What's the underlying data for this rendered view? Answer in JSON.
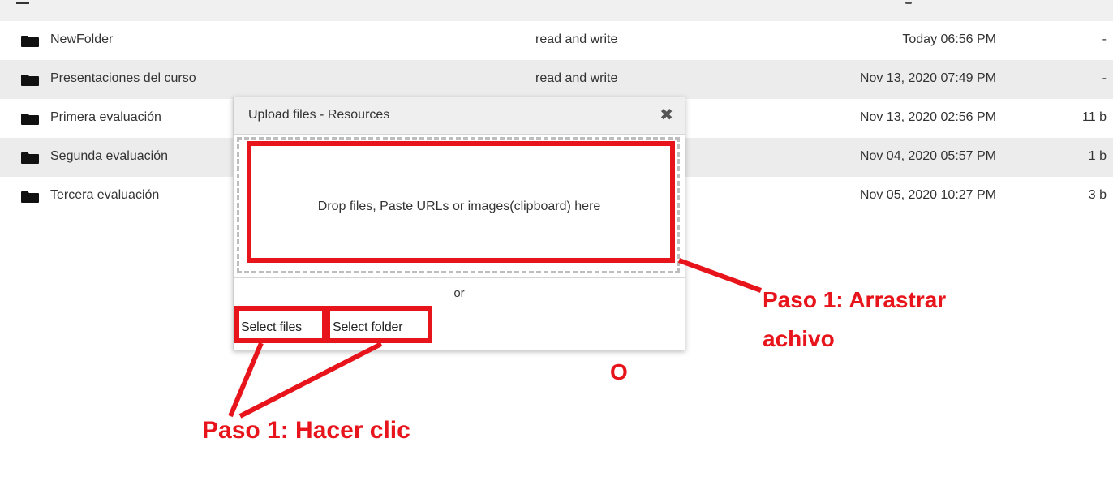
{
  "file_list": {
    "rows": [
      {
        "name": "NewFolder",
        "permission": "read and write",
        "date": "Today 06:56 PM",
        "size": "-"
      },
      {
        "name": "Presentaciones del curso",
        "permission": "read and write",
        "date": "Nov 13, 2020 07:49 PM",
        "size": "-"
      },
      {
        "name": "Primera evaluación",
        "permission": "",
        "date": "Nov 13, 2020 02:56 PM",
        "size": "11 b"
      },
      {
        "name": "Segunda evaluación",
        "permission": "",
        "date": "Nov 04, 2020 05:57 PM",
        "size": "1 b"
      },
      {
        "name": "Tercera evaluación",
        "permission": "",
        "date": "Nov 05, 2020 10:27 PM",
        "size": "3 b"
      }
    ]
  },
  "upload_dialog": {
    "title": "Upload files - Resources",
    "close_glyph": "✖",
    "drop_text": "Drop files, Paste URLs or images(clipboard) here",
    "or_text": "or",
    "select_files_label": "Select files",
    "select_folder_label": "Select folder"
  },
  "annotations": {
    "drag_label_line1": "Paso 1: Arrastrar",
    "drag_label_line2": "achivo",
    "or_label": "O",
    "click_label": "Paso 1: Hacer clic",
    "color": "#e8141b"
  },
  "icons": {
    "folder": "folder-icon",
    "close": "close-icon"
  }
}
